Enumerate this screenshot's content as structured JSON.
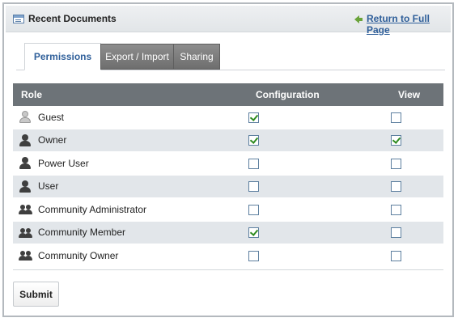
{
  "portlet": {
    "title": "Recent Documents",
    "return_link": "Return to Full Page"
  },
  "tabs": [
    {
      "label": "Permissions",
      "active": true
    },
    {
      "label": "Export / Import",
      "active": false
    },
    {
      "label": "Sharing",
      "active": false
    }
  ],
  "table": {
    "headers": {
      "role": "Role",
      "configuration": "Configuration",
      "view": "View"
    },
    "rows": [
      {
        "role": "Guest",
        "icon": "guest-user-icon",
        "configuration": true,
        "view": false
      },
      {
        "role": "Owner",
        "icon": "user-icon",
        "configuration": true,
        "view": true
      },
      {
        "role": "Power User",
        "icon": "user-icon",
        "configuration": false,
        "view": false
      },
      {
        "role": "User",
        "icon": "user-icon",
        "configuration": false,
        "view": false
      },
      {
        "role": "Community Administrator",
        "icon": "group-icon",
        "configuration": false,
        "view": false
      },
      {
        "role": "Community Member",
        "icon": "group-icon",
        "configuration": true,
        "view": false
      },
      {
        "role": "Community Owner",
        "icon": "group-icon",
        "configuration": false,
        "view": false
      }
    ]
  },
  "submit_label": "Submit",
  "colors": {
    "header_bg": "#6d7378",
    "row_alt_bg": "#e2e6ea",
    "link": "#2f5f9a",
    "check": "#2e8b1f"
  }
}
